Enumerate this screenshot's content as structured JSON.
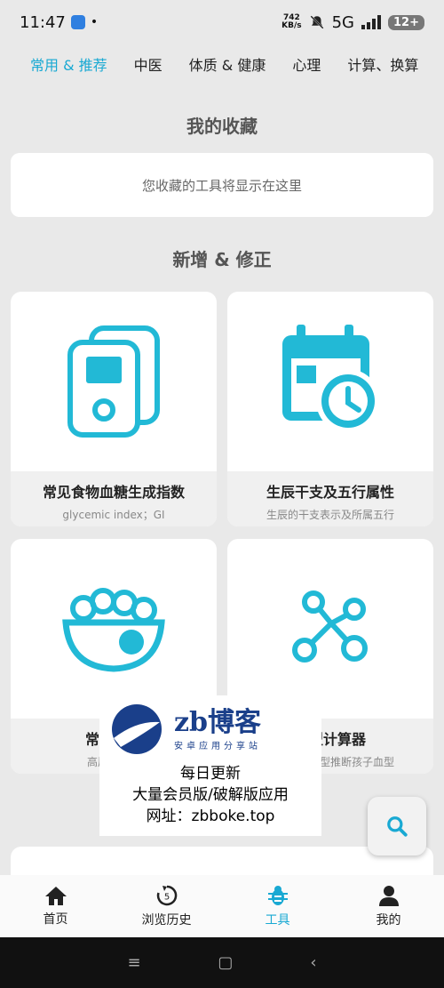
{
  "status_bar": {
    "time": "11:47",
    "dot": "•",
    "net_rate_value": "742",
    "net_rate_unit": "KB/s",
    "network": "5G",
    "battery": "12+"
  },
  "tabs": [
    {
      "label": "常用 & 推荐",
      "active": true
    },
    {
      "label": "中医",
      "active": false
    },
    {
      "label": "体质 & 健康",
      "active": false
    },
    {
      "label": "心理",
      "active": false
    },
    {
      "label": "计算、换算",
      "active": false
    }
  ],
  "favorites": {
    "title": "我的收藏",
    "empty_text": "您收藏的工具将显示在这里"
  },
  "new_section": {
    "title": "新增 & 修正"
  },
  "cards": [
    {
      "title": "常见食物血糖生成指数",
      "subtitle": "glycemic index；GI",
      "icon": "food-glucose-meter-icon"
    },
    {
      "title": "生辰干支及五行属性",
      "subtitle": "生辰的干支表示及所属五行",
      "icon": "calendar-clock-icon"
    },
    {
      "title": "常见食物",
      "subtitle": "高尿酸血症",
      "icon": "food-bowl-icon"
    },
    {
      "title": "血型计算器",
      "subtitle": "根据父母血型推断孩子血型",
      "icon": "molecule-icon"
    }
  ],
  "watermark": {
    "brand": "zb博客",
    "brand_sub": "安卓应用分享站",
    "line1": "每日更新",
    "line2": "大量会员版/破解版应用",
    "line3": "网址：zbboke.top"
  },
  "bottom_nav": [
    {
      "label": "首页",
      "icon": "home-icon",
      "active": false
    },
    {
      "label": "浏览历史",
      "icon": "history-icon",
      "active": false
    },
    {
      "label": "工具",
      "icon": "tools-bug-icon",
      "active": true
    },
    {
      "label": "我的",
      "icon": "person-icon",
      "active": false
    }
  ],
  "system_nav": {
    "menu": "≡",
    "home": "▢",
    "back": "‹"
  },
  "colors": {
    "accent": "#19a9d3",
    "icon": "#22b9d6",
    "background": "#e9e9e9"
  }
}
